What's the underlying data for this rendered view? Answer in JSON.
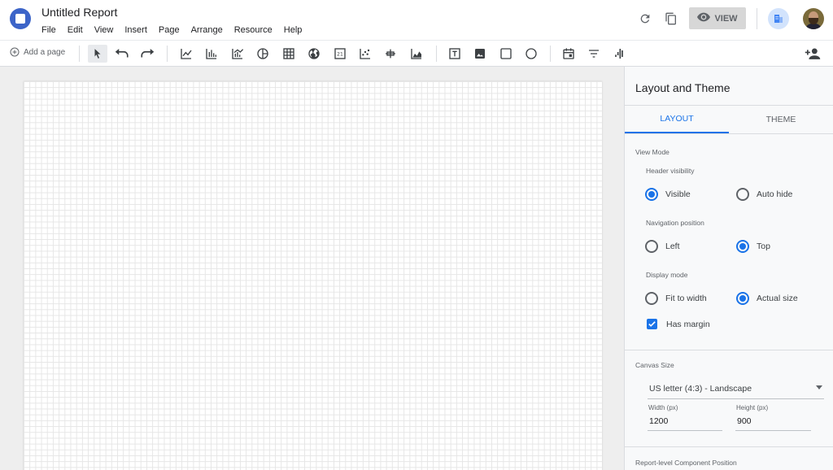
{
  "app": {
    "title": "Untitled Report",
    "menu": [
      "File",
      "Edit",
      "View",
      "Insert",
      "Page",
      "Arrange",
      "Resource",
      "Help"
    ],
    "view_button_label": "VIEW",
    "accent_color": "#1a73e8"
  },
  "toolbar": {
    "add_page_label": "Add a page",
    "tools": [
      "select-icon",
      "undo-icon",
      "redo-icon",
      "time-series-chart-icon",
      "bar-chart-icon",
      "combo-chart-icon",
      "pie-chart-icon",
      "table-icon",
      "geo-map-icon",
      "scorecard-icon",
      "scatter-chart-icon",
      "bullet-chart-icon",
      "area-chart-icon",
      "text-icon",
      "image-icon",
      "rectangle-icon",
      "circle-icon",
      "date-range-icon",
      "filter-control-icon",
      "data-control-icon",
      "add-person-icon"
    ]
  },
  "panel": {
    "title": "Layout and Theme",
    "tabs": [
      {
        "label": "LAYOUT",
        "active": true
      },
      {
        "label": "THEME",
        "active": false
      }
    ],
    "view_mode": {
      "section_label": "View Mode",
      "header_visibility": {
        "label": "Header visibility",
        "options": [
          {
            "label": "Visible",
            "selected": true
          },
          {
            "label": "Auto hide",
            "selected": false
          }
        ]
      },
      "navigation_position": {
        "label": "Navigation position",
        "options": [
          {
            "label": "Left",
            "selected": false
          },
          {
            "label": "Top",
            "selected": true
          }
        ]
      },
      "display_mode": {
        "label": "Display mode",
        "options": [
          {
            "label": "Fit to width",
            "selected": false
          },
          {
            "label": "Actual size",
            "selected": true
          }
        ]
      },
      "has_margin": {
        "label": "Has margin",
        "checked": true
      }
    },
    "canvas_size": {
      "section_label": "Canvas Size",
      "preset": "US letter (4:3) - Landscape",
      "width_label": "Width (px)",
      "width_value": "1200",
      "height_label": "Height (px)",
      "height_value": "900"
    },
    "component_position": {
      "section_label": "Report-level Component Position"
    }
  }
}
